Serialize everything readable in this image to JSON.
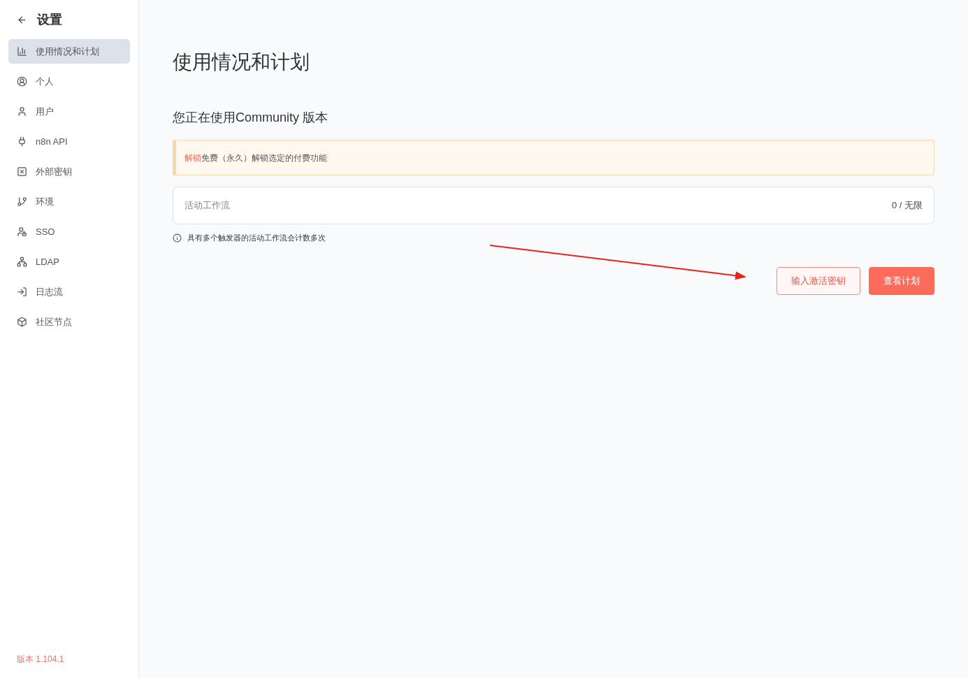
{
  "sidebar": {
    "title": "设置",
    "items": [
      {
        "label": "使用情况和计划",
        "selected": true
      },
      {
        "label": "个人",
        "selected": false
      },
      {
        "label": "用户",
        "selected": false
      },
      {
        "label": "n8n API",
        "selected": false
      },
      {
        "label": "外部密钥",
        "selected": false
      },
      {
        "label": "环境",
        "selected": false
      },
      {
        "label": "SSO",
        "selected": false
      },
      {
        "label": "LDAP",
        "selected": false
      },
      {
        "label": "日志流",
        "selected": false
      },
      {
        "label": "社区节点",
        "selected": false
      }
    ],
    "version": "版本 1.104.1"
  },
  "main": {
    "title": "使用情况和计划",
    "subtitle": "您正在使用Community 版本",
    "notice": {
      "link": "解锁",
      "text": "免费（永久）解锁选定的付费功能"
    },
    "usage": {
      "label": "活动工作流",
      "value": "0 / 无限"
    },
    "hint": "具有多个触发器的活动工作流会计数多次",
    "buttons": [
      {
        "label": "输入激活密钥",
        "kind": "secondary"
      },
      {
        "label": "查看计划",
        "kind": "primary"
      }
    ]
  }
}
